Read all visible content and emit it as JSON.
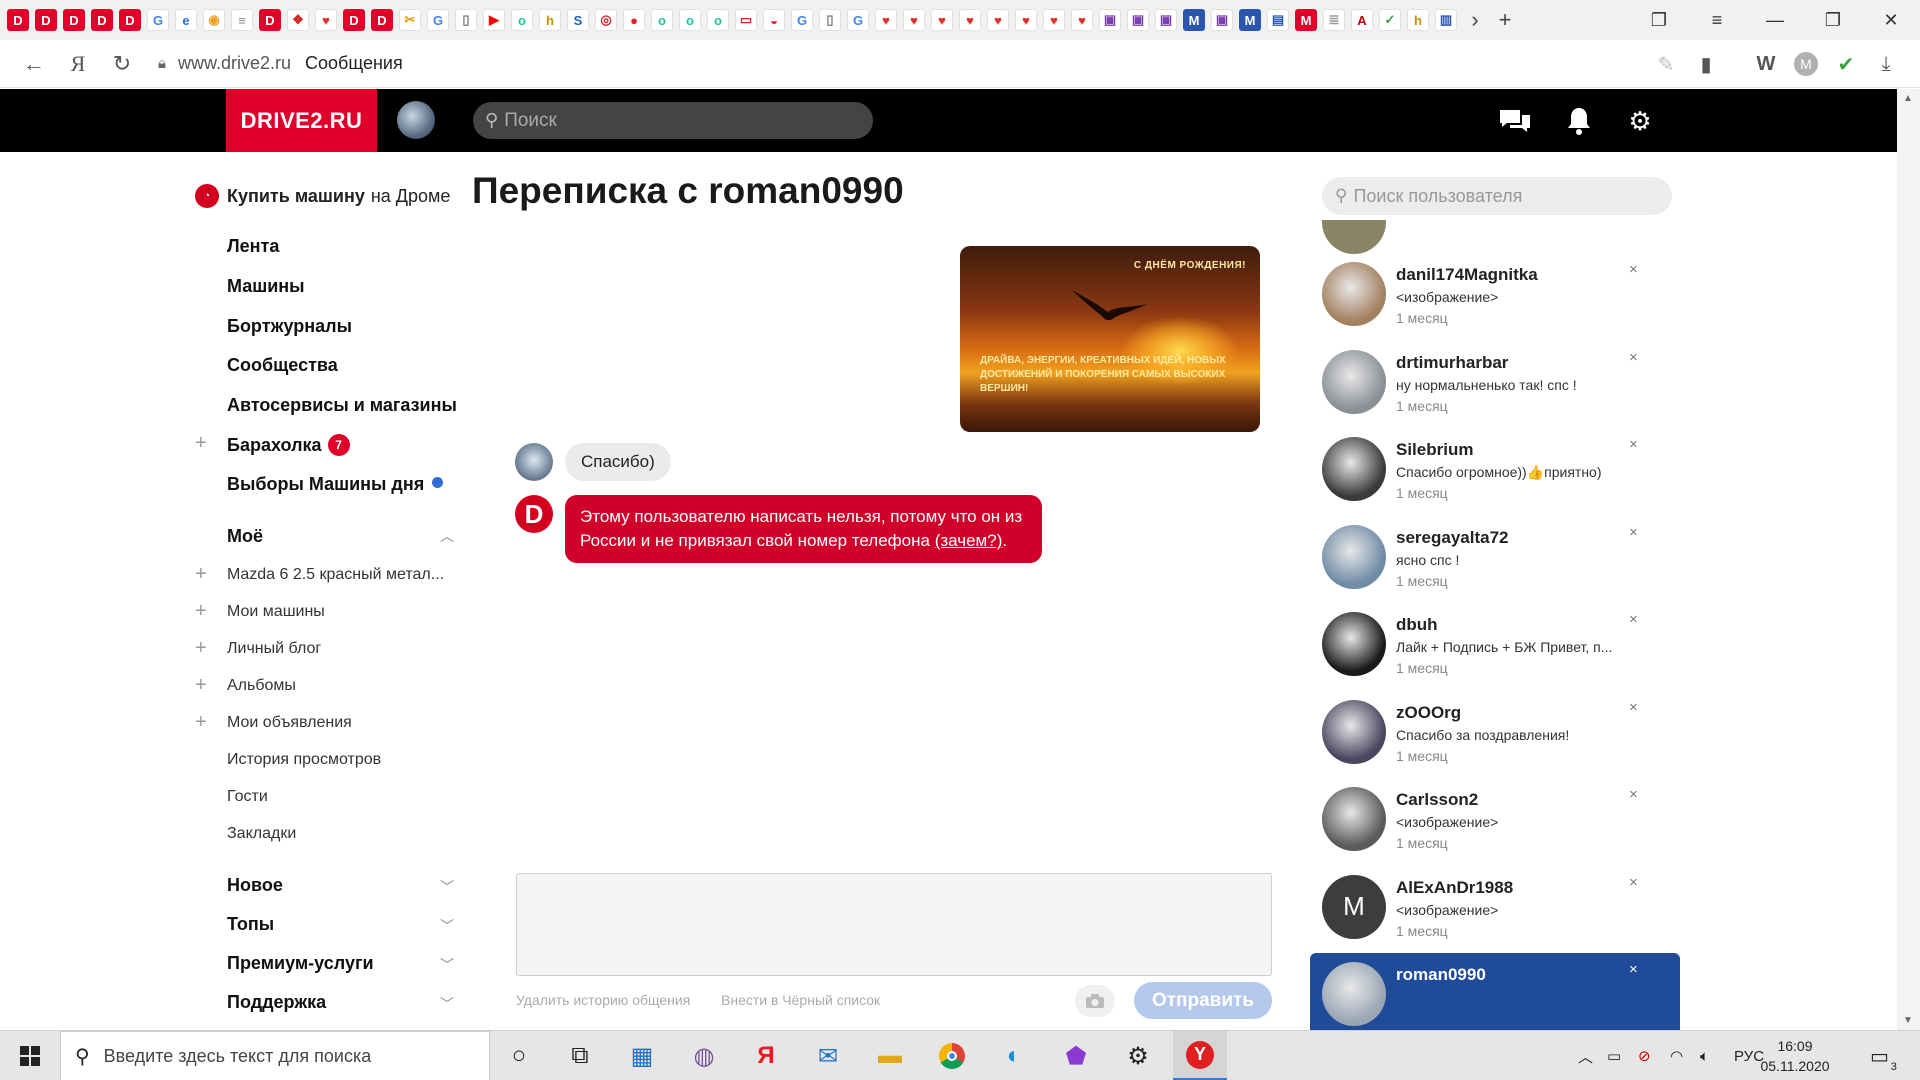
{
  "browser": {
    "url_host": "www.drive2.ru",
    "tab_title": "Сообщения",
    "tab_favicons": [
      {
        "letter": "D",
        "color": "#e0002a"
      },
      {
        "letter": "D",
        "color": "#e0002a"
      },
      {
        "letter": "D",
        "color": "#e0002a"
      },
      {
        "letter": "D",
        "color": "#e0002a"
      },
      {
        "letter": "D",
        "color": "#e0002a"
      },
      {
        "letter": "G",
        "color": "#4285f4"
      },
      {
        "letter": "e",
        "color": "#2a6fd6"
      },
      {
        "letter": "◉",
        "color": "#f0a020"
      },
      {
        "letter": "≡",
        "color": "#888888"
      },
      {
        "letter": "D",
        "color": "#e0002a"
      },
      {
        "letter": "❖",
        "color": "#d42020"
      },
      {
        "letter": "♥",
        "color": "#e0302a"
      },
      {
        "letter": "D",
        "color": "#e0002a"
      },
      {
        "letter": "D",
        "color": "#e0002a"
      },
      {
        "letter": "✂",
        "color": "#e0a000"
      },
      {
        "letter": "G",
        "color": "#4285f4"
      },
      {
        "letter": "▯",
        "color": "#777777"
      },
      {
        "letter": "▶",
        "color": "#ff0000"
      },
      {
        "letter": "o",
        "color": "#23c6a0"
      },
      {
        "letter": "h",
        "color": "#c69000"
      },
      {
        "letter": "S",
        "color": "#1d60c0"
      },
      {
        "letter": "◎",
        "color": "#d42020"
      },
      {
        "letter": "●",
        "color": "#e02020"
      },
      {
        "letter": "o",
        "color": "#23c6a0"
      },
      {
        "letter": "o",
        "color": "#23c6a0"
      },
      {
        "letter": "o",
        "color": "#23c6a0"
      },
      {
        "letter": "▭",
        "color": "#e02020"
      },
      {
        "letter": "◒",
        "color": "#e02020"
      },
      {
        "letter": "G",
        "color": "#4285f4"
      },
      {
        "letter": "▯",
        "color": "#777777"
      },
      {
        "letter": "G",
        "color": "#4285f4"
      },
      {
        "letter": "♥",
        "color": "#e0302a"
      },
      {
        "letter": "♥",
        "color": "#e0302a"
      },
      {
        "letter": "♥",
        "color": "#e0302a"
      },
      {
        "letter": "♥",
        "color": "#e0302a"
      },
      {
        "letter": "♥",
        "color": "#e0302a"
      },
      {
        "letter": "♥",
        "color": "#e0302a"
      },
      {
        "letter": "♥",
        "color": "#e0302a"
      },
      {
        "letter": "♥",
        "color": "#e0302a"
      },
      {
        "letter": "▣",
        "color": "#7a3fb0"
      },
      {
        "letter": "▣",
        "color": "#7a3fb0"
      },
      {
        "letter": "▣",
        "color": "#7a3fb0"
      },
      {
        "letter": "M",
        "color": "#2a56b0"
      },
      {
        "letter": "▣",
        "color": "#7a3fb0"
      },
      {
        "letter": "M",
        "color": "#2a56b0"
      },
      {
        "letter": "▤",
        "color": "#2a56b0"
      },
      {
        "letter": "M",
        "color": "#e0002a"
      },
      {
        "letter": "≣",
        "color": "#999999"
      },
      {
        "letter": "A",
        "color": "#c00000"
      },
      {
        "letter": "✓",
        "color": "#3aa040"
      },
      {
        "letter": "h",
        "color": "#c69000"
      },
      {
        "letter": "▥",
        "color": "#2a56b0"
      }
    ]
  },
  "site": {
    "logo": "DRIVE2.RU",
    "search_placeholder": "Поиск"
  },
  "sidebar": {
    "buy_car_bold": "Купить машину",
    "buy_car_rest": "на Дроме",
    "main_items": [
      {
        "label": "Лента"
      },
      {
        "label": "Машины"
      },
      {
        "label": "Бортжурналы"
      },
      {
        "label": "Сообщества"
      },
      {
        "label": "Автосервисы и магазины"
      },
      {
        "label": "Барахолка",
        "badge": "7"
      },
      {
        "label": "Выборы Машины дня"
      }
    ],
    "mine_title": "Моё",
    "mine_items": [
      {
        "label": "Mazda 6 2.5 красный метал..."
      },
      {
        "label": "Мои машины"
      },
      {
        "label": "Личный блог"
      },
      {
        "label": "Альбомы"
      },
      {
        "label": "Мои объявления"
      },
      {
        "label": "История просмотров"
      },
      {
        "label": "Гости"
      },
      {
        "label": "Закладки"
      }
    ],
    "sections": [
      {
        "label": "Новое"
      },
      {
        "label": "Топы"
      },
      {
        "label": "Премиум-услуги"
      },
      {
        "label": "Поддержка"
      }
    ]
  },
  "conversation": {
    "title": "Переписка с roman0990",
    "card_header": "С ДНЁМ РОЖДЕНИЯ!",
    "card_text": "ДРАЙВА, ЭНЕРГИИ, КРЕАТИВНЫХ ИДЕЙ, НОВЫХ ДОСТИЖЕНИЙ И ПОКОРЕНИЯ САМЫХ ВЫСОКИХ ВЕРШИН!",
    "reply_text": "Спасибо)",
    "system_avatar_letter": "D",
    "system_text": "Этому пользователю написать нельзя, потому что он из России и не привязал свой номер телефона",
    "system_link": "(зачем?)",
    "system_link_after": ".",
    "delete_history": "Удалить историю общения",
    "blacklist": "Внести в Чёрный список",
    "send_label": "Отправить"
  },
  "dialogs": {
    "search_placeholder": "Поиск пользователя",
    "items": [
      {
        "name": "danil174Magnitka",
        "preview": "<изображение>",
        "time": "1 месяц",
        "avatar": "#a38060"
      },
      {
        "name": "drtimurharbar",
        "preview": "ну нормальненько так! спс !",
        "time": "1 месяц",
        "avatar": "#8a8f96"
      },
      {
        "name": "Silebrium",
        "preview": "Спасибо огромное))👍приятно)",
        "time": "1 месяц",
        "avatar": "#3a3a3a"
      },
      {
        "name": "seregayalta72",
        "preview": "ясно спс !",
        "time": "1 месяц",
        "avatar": "#6f8ba5"
      },
      {
        "name": "dbuh",
        "preview": "Лайк + Подпись + БЖ Привет, п...",
        "time": "1 месяц",
        "avatar": "#1a1a1a"
      },
      {
        "name": "zOOOrg",
        "preview": "Спасибо за поздравления!",
        "time": "1 месяц",
        "avatar": "#4a4660"
      },
      {
        "name": "Carlsson2",
        "preview": "<изображение>",
        "time": "1 месяц",
        "avatar": "#5a5a5a"
      },
      {
        "name": "AlExAnDr1988",
        "preview": "<изображение>",
        "time": "1 месяц",
        "avatar": "#3d3d3d",
        "letter": "M"
      },
      {
        "name": "roman0990",
        "preview": "",
        "time": "",
        "avatar": "#9aa6b4",
        "active": true
      }
    ]
  },
  "taskbar": {
    "search_text": "Введите здесь текст для поиска",
    "lang": "РУС",
    "time": "16:09",
    "date": "05.11.2020",
    "notif_count": "3"
  }
}
